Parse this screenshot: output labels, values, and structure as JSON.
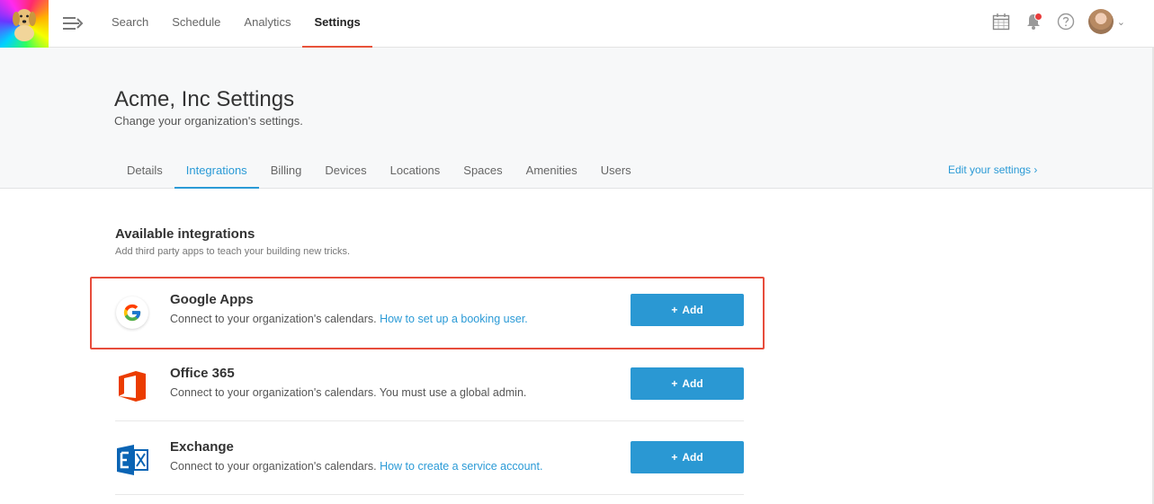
{
  "nav": {
    "items": [
      {
        "label": "Search",
        "active": false
      },
      {
        "label": "Schedule",
        "active": false
      },
      {
        "label": "Analytics",
        "active": false
      },
      {
        "label": "Settings",
        "active": true
      }
    ],
    "icons": [
      "menu-icon",
      "calendar-icon",
      "bell-icon",
      "help-icon",
      "avatar",
      "chevron-down-icon"
    ],
    "accent_color": "#e8523a"
  },
  "header": {
    "title": "Acme, Inc Settings",
    "subtitle": "Change your organization's settings.",
    "tabs": [
      {
        "label": "Details",
        "active": false
      },
      {
        "label": "Integrations",
        "active": true
      },
      {
        "label": "Billing",
        "active": false
      },
      {
        "label": "Devices",
        "active": false
      },
      {
        "label": "Locations",
        "active": false
      },
      {
        "label": "Spaces",
        "active": false
      },
      {
        "label": "Amenities",
        "active": false
      },
      {
        "label": "Users",
        "active": false
      }
    ],
    "edit_link": "Edit your settings ›",
    "tab_accent_color": "#2a9ad6"
  },
  "integrations": {
    "title": "Available integrations",
    "subtitle": "Add third party apps to teach your building new tricks.",
    "items": [
      {
        "name": "Google Apps",
        "icon": "google-icon",
        "description": "Connect to your organization's calendars. ",
        "link": "How to set up a booking user.",
        "button": "Add",
        "highlighted": true
      },
      {
        "name": "Office 365",
        "icon": "office365-icon",
        "description": "Connect to your organization's calendars. You must use a global admin.",
        "link": "",
        "button": "Add",
        "highlighted": false
      },
      {
        "name": "Exchange",
        "icon": "exchange-icon",
        "description": "Connect to your organization's calendars. ",
        "link": "How to create a service account.",
        "button": "Add",
        "highlighted": false
      }
    ],
    "button_color": "#2a98d3",
    "highlight_color": "#e74c3c"
  }
}
